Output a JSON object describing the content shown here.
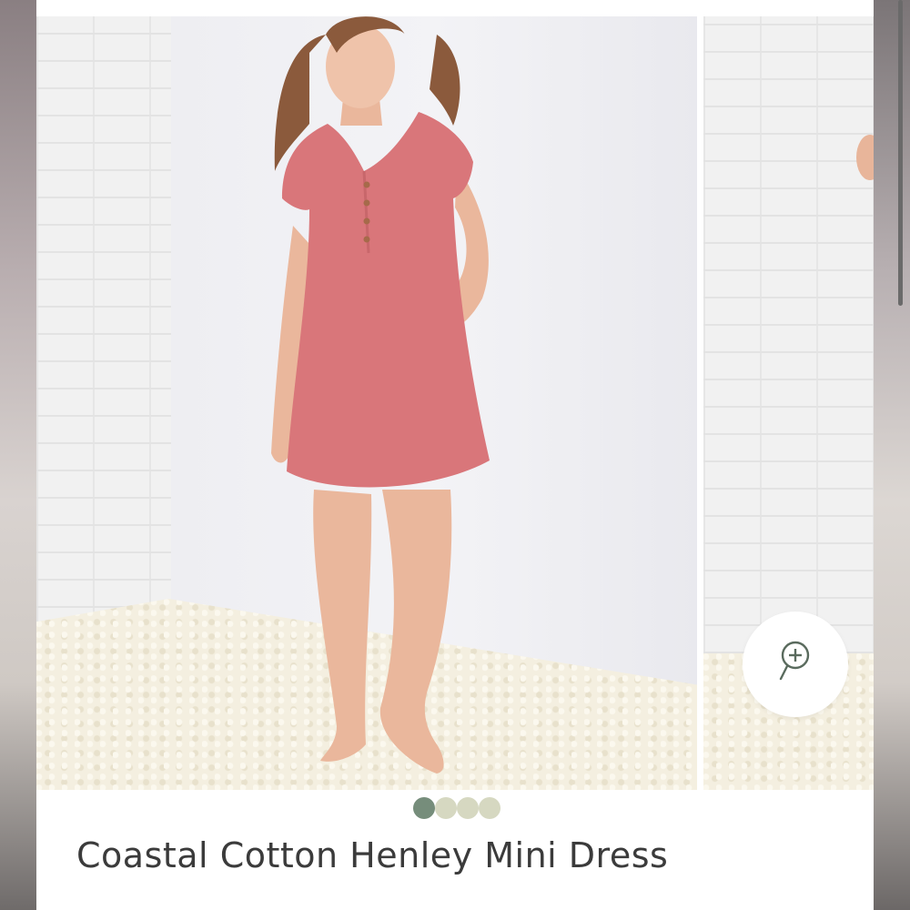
{
  "product": {
    "title": "Coastal Cotton Henley Mini Dress"
  },
  "gallery": {
    "zoom_icon": "zoom-in-icon",
    "colors": {
      "dress": "#d9767a",
      "rug": "#f4efe0",
      "wall": "#f1f1f1"
    }
  },
  "swatches": [
    {
      "color": "#768d7b"
    },
    {
      "color": "#d6d8c1"
    },
    {
      "color": "#d6d8c1"
    },
    {
      "color": "#d6d8c1"
    }
  ]
}
